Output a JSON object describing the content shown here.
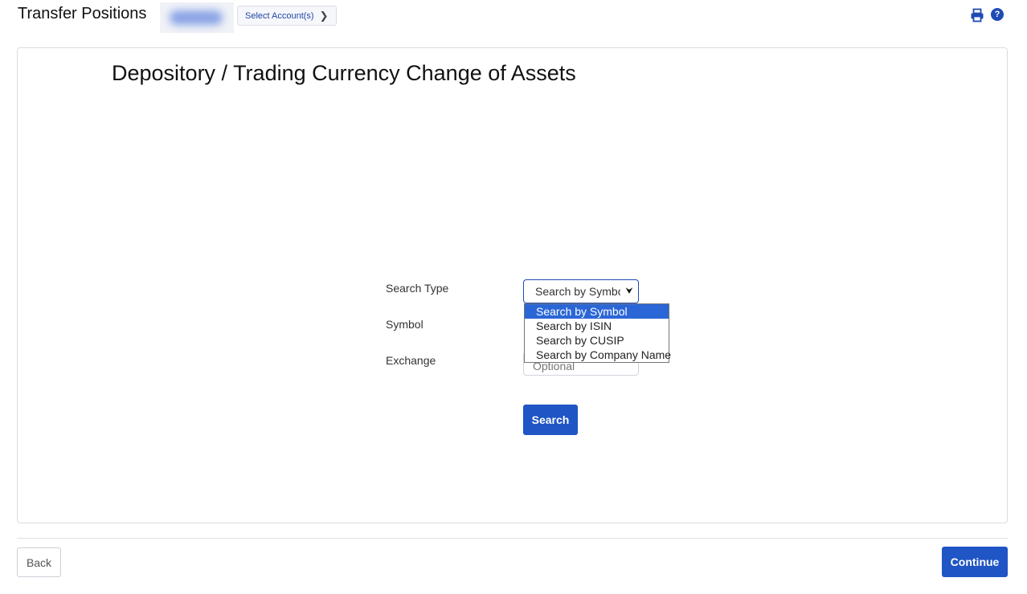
{
  "header": {
    "title": "Transfer Positions",
    "select_account_label": "Select Account(s)",
    "print_icon": "print-icon",
    "help_icon": "help-icon",
    "help_glyph": "?"
  },
  "main": {
    "section_title": "Depository / Trading Currency Change of Assets",
    "form": {
      "search_type_label": "Search Type",
      "symbol_label": "Symbol",
      "exchange_label": "Exchange",
      "search_type_value": "Search by Symbol",
      "search_type_options": [
        "Search by Symbol",
        "Search by ISIN",
        "Search by CUSIP",
        "Search by Company Name"
      ],
      "exchange_placeholder": "Optional",
      "search_button": "Search"
    }
  },
  "footer": {
    "back_label": "Back",
    "continue_label": "Continue"
  },
  "colors": {
    "accent": "#1f55c4",
    "dropdown_selected": "#2b66d6"
  }
}
